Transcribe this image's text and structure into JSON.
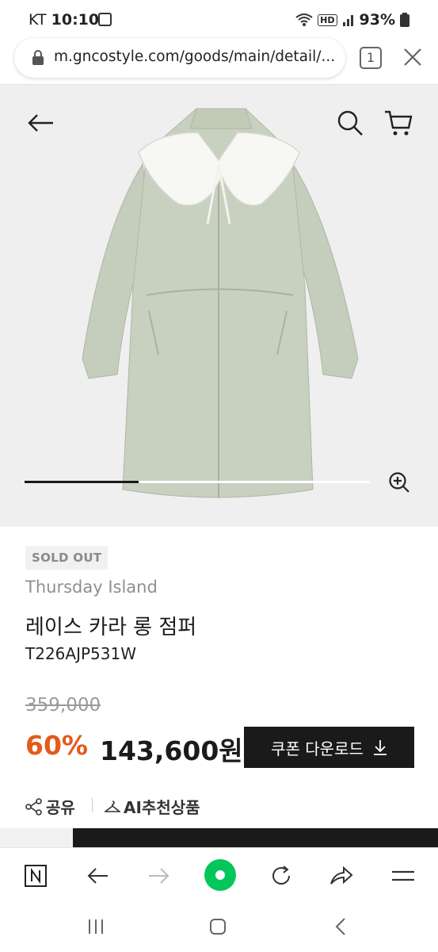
{
  "status_bar": {
    "carrier": "KT",
    "time": "10:10",
    "hd_label": "HD",
    "battery": "93%"
  },
  "browser": {
    "url": "m.gncostyle.com/goods/main/detail/...",
    "tab_count": "1"
  },
  "product": {
    "image_slider_progress": 0.33,
    "badge": "SOLD OUT",
    "brand": "Thursday Island",
    "name": "레이스 카라 롱 점퍼",
    "code": "T226AJP531W",
    "original_price": "359,000",
    "discount": "60%",
    "sale_price": "143,600원",
    "coupon_label": "쿠폰 다운로드",
    "share_label": "공유",
    "ai_label": "AI추천상품"
  },
  "icons": {
    "back": "arrow-left-icon",
    "search": "search-icon",
    "cart": "cart-icon",
    "zoom": "zoom-in-icon",
    "download": "download-icon",
    "share": "share-icon",
    "ai": "ai-hanger-icon"
  },
  "colors": {
    "discount": "#e35a1b",
    "coupon_bg": "#1a1a1a",
    "naver_green": "#03c75a",
    "hero_bg": "#efefef",
    "jacket": "#c7cfbf"
  }
}
